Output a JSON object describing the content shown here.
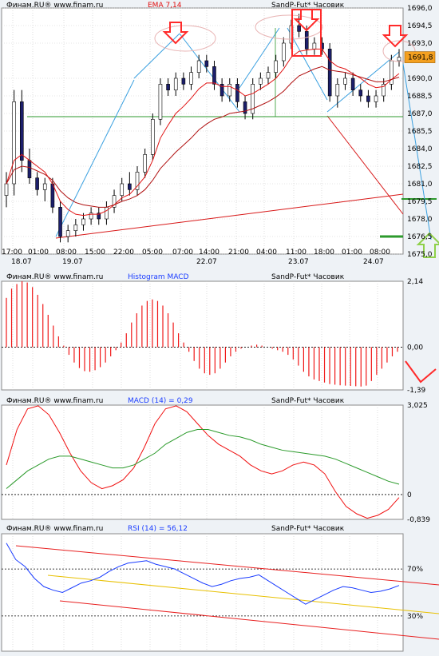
{
  "colors": {
    "bg": "#eef2f6",
    "plot": "#ffffff",
    "grid": "#c9c9c9",
    "candleUp": "#ffffff",
    "candleDown": "#1c1f6b",
    "candleEdge": "#000000",
    "emaFast": "#e01515",
    "emaSlow": "#b01010",
    "trend": "#3aa0e0",
    "support": "#d81818",
    "green": "#2c9a2c",
    "arrow": "#ff2a2a",
    "hist": "#f01818",
    "macd": "#f01010",
    "signal": "#2a9a2a",
    "rsi": "#1a3cff",
    "rsiTrend": "#e82020",
    "rsiMid": "#e8c000",
    "pill": "#e8b3b3",
    "priceBox": "#f4a020"
  },
  "panels": [
    {
      "id": "price",
      "source": "Финам.RU®  www.finam.ru",
      "indicator": "EMA 7,14",
      "instrument": "SandP-Fut* Часовик",
      "yticks": [
        "1696,0",
        "1694,5",
        "1693,0",
        "1691,8",
        "1690,0",
        "1688,5",
        "1687,0",
        "1685,5",
        "1684,0",
        "1682,5",
        "1681,0",
        "1679,5",
        "1678,0",
        "1676,5",
        "1675,0"
      ],
      "current_price": "1691,8"
    },
    {
      "id": "hist",
      "source": "Финам.RU®  www.finam.ru",
      "indicator": "Histogram MACD",
      "instrument": "SandP-Fut* Часовик",
      "yticks": [
        "2,14",
        "0,00",
        "-1,39"
      ]
    },
    {
      "id": "macd",
      "source": "Финам.RU®  www.finam.ru",
      "indicator": "MACD (14) = 0,29",
      "instrument": "SandP-Fut* Часовик",
      "yticks": [
        "3,025",
        "0",
        "-0,839"
      ]
    },
    {
      "id": "rsi",
      "source": "Финам.RU®  www.finam.ru",
      "indicator": "RSI (14) = 56,12",
      "instrument": "SandP-Fut* Часовик",
      "yticks": [
        "70%",
        "30%"
      ]
    }
  ],
  "xaxis": {
    "times": [
      "17:00",
      "01:00",
      "08:00",
      "15:00",
      "22:00",
      "05:00",
      "07:00",
      "14:00",
      "21:00",
      "04:00",
      "11:00",
      "18:00",
      "01:00",
      "08:00"
    ],
    "dates": [
      "18.07",
      "19.07",
      "22.07",
      "23.07",
      "24.07"
    ]
  },
  "chart_data": [
    {
      "type": "candlestick",
      "title": "SandP-Fut* Часовик",
      "indicator": "EMA 7,14",
      "ylim": [
        1675.0,
        1696.0
      ],
      "candles_ohlc": [
        [
          1680.0,
          1682.0,
          1679.0,
          1681.0
        ],
        [
          1681.0,
          1689.0,
          1680.0,
          1688.0
        ],
        [
          1688.0,
          1689.0,
          1682.0,
          1683.0
        ],
        [
          1683.0,
          1684.0,
          1681.0,
          1681.5
        ],
        [
          1681.5,
          1682.0,
          1680.0,
          1680.5
        ],
        [
          1680.5,
          1681.5,
          1679.5,
          1681.0
        ],
        [
          1681.0,
          1681.5,
          1678.5,
          1679.0
        ],
        [
          1679.0,
          1679.5,
          1676.0,
          1676.5
        ],
        [
          1676.5,
          1677.5,
          1676.0,
          1677.0
        ],
        [
          1677.0,
          1678.0,
          1676.5,
          1677.5
        ],
        [
          1677.5,
          1678.5,
          1677.0,
          1678.0
        ],
        [
          1678.0,
          1679.0,
          1677.5,
          1678.5
        ],
        [
          1678.5,
          1679.0,
          1677.5,
          1678.0
        ],
        [
          1678.0,
          1679.5,
          1677.5,
          1679.0
        ],
        [
          1679.0,
          1680.5,
          1678.5,
          1680.0
        ],
        [
          1680.0,
          1681.5,
          1679.5,
          1681.0
        ],
        [
          1681.0,
          1682.0,
          1680.0,
          1680.5
        ],
        [
          1680.5,
          1682.5,
          1680.0,
          1682.0
        ],
        [
          1682.0,
          1684.0,
          1681.5,
          1683.5
        ],
        [
          1683.5,
          1687.0,
          1683.0,
          1686.5
        ],
        [
          1686.5,
          1690.0,
          1686.0,
          1689.5
        ],
        [
          1689.5,
          1690.0,
          1688.5,
          1689.0
        ],
        [
          1689.0,
          1690.5,
          1688.5,
          1690.0
        ],
        [
          1690.0,
          1690.5,
          1689.0,
          1689.5
        ],
        [
          1689.5,
          1691.0,
          1689.0,
          1690.5
        ],
        [
          1690.5,
          1692.0,
          1690.0,
          1691.5
        ],
        [
          1691.5,
          1692.0,
          1690.5,
          1691.0
        ],
        [
          1691.0,
          1691.5,
          1689.0,
          1689.5
        ],
        [
          1689.5,
          1690.0,
          1688.0,
          1688.5
        ],
        [
          1688.5,
          1690.0,
          1688.0,
          1689.5
        ],
        [
          1689.5,
          1690.0,
          1687.5,
          1688.0
        ],
        [
          1688.0,
          1688.5,
          1686.5,
          1687.0
        ],
        [
          1687.0,
          1690.0,
          1686.5,
          1689.5
        ],
        [
          1689.5,
          1690.5,
          1689.0,
          1690.0
        ],
        [
          1690.0,
          1691.0,
          1689.5,
          1690.5
        ],
        [
          1690.5,
          1692.0,
          1690.0,
          1691.5
        ],
        [
          1691.5,
          1693.5,
          1691.0,
          1693.0
        ],
        [
          1693.0,
          1695.0,
          1692.5,
          1694.5
        ],
        [
          1694.5,
          1695.5,
          1693.5,
          1694.0
        ],
        [
          1694.0,
          1694.5,
          1692.0,
          1692.5
        ],
        [
          1692.5,
          1693.5,
          1692.0,
          1693.0
        ],
        [
          1693.0,
          1693.5,
          1692.0,
          1692.5
        ],
        [
          1692.5,
          1693.0,
          1688.0,
          1688.5
        ],
        [
          1688.5,
          1690.0,
          1687.5,
          1689.5
        ],
        [
          1689.5,
          1690.5,
          1689.0,
          1690.0
        ],
        [
          1690.0,
          1690.5,
          1688.5,
          1689.0
        ],
        [
          1689.0,
          1689.5,
          1688.0,
          1688.5
        ],
        [
          1688.5,
          1689.0,
          1687.5,
          1688.0
        ],
        [
          1688.0,
          1689.0,
          1687.5,
          1688.5
        ],
        [
          1688.5,
          1690.0,
          1688.0,
          1689.5
        ],
        [
          1689.5,
          1692.0,
          1689.0,
          1691.5
        ],
        [
          1691.5,
          1692.5,
          1691.0,
          1691.8
        ]
      ],
      "ema_fast": [
        1681.0,
        1683.0,
        1683.5,
        1683.0,
        1682.5,
        1682.0,
        1681.0,
        1679.5,
        1678.8,
        1678.4,
        1678.3,
        1678.4,
        1678.4,
        1678.7,
        1679.2,
        1679.8,
        1680.1,
        1680.8,
        1681.6,
        1683.0,
        1684.9,
        1686.0,
        1687.0,
        1687.6,
        1688.3,
        1689.1,
        1689.6,
        1689.6,
        1689.3,
        1689.3,
        1689.0,
        1688.5,
        1688.7,
        1689.1,
        1689.5,
        1690.0,
        1690.8,
        1691.8,
        1692.3,
        1692.4,
        1692.5,
        1692.5,
        1691.5,
        1691.0,
        1690.8,
        1690.4,
        1690.0,
        1689.5,
        1689.2,
        1689.3,
        1689.9,
        1690.4
      ],
      "ema_slow": [
        1681.0,
        1682.2,
        1682.5,
        1682.4,
        1682.1,
        1681.8,
        1681.3,
        1680.4,
        1679.8,
        1679.4,
        1679.2,
        1679.1,
        1679.0,
        1679.0,
        1679.2,
        1679.5,
        1679.7,
        1680.0,
        1680.5,
        1681.3,
        1682.3,
        1683.0,
        1683.7,
        1684.3,
        1684.9,
        1685.6,
        1686.1,
        1686.5,
        1686.7,
        1687.0,
        1687.1,
        1687.2,
        1687.4,
        1687.7,
        1688.0,
        1688.4,
        1688.9,
        1689.6,
        1690.2,
        1690.5,
        1690.8,
        1691.0,
        1690.7,
        1690.6,
        1690.5,
        1690.3,
        1690.1,
        1689.9,
        1689.7,
        1689.7,
        1689.9,
        1690.1
      ]
    },
    {
      "type": "bar",
      "title": "Histogram MACD",
      "ylim": [
        -1.39,
        2.14
      ],
      "values": [
        1.6,
        1.9,
        2.05,
        2.14,
        2.1,
        1.95,
        1.7,
        1.4,
        1.05,
        0.7,
        0.35,
        0.05,
        -0.25,
        -0.5,
        -0.68,
        -0.78,
        -0.8,
        -0.75,
        -0.65,
        -0.5,
        -0.3,
        -0.1,
        0.15,
        0.45,
        0.8,
        1.1,
        1.35,
        1.5,
        1.55,
        1.5,
        1.35,
        1.1,
        0.8,
        0.45,
        0.15,
        -0.15,
        -0.45,
        -0.7,
        -0.85,
        -0.9,
        -0.85,
        -0.7,
        -0.5,
        -0.3,
        -0.15,
        -0.05,
        0.0,
        0.05,
        0.08,
        0.05,
        0.0,
        -0.05,
        -0.1,
        -0.15,
        -0.25,
        -0.4,
        -0.6,
        -0.8,
        -0.95,
        -1.05,
        -1.1,
        -1.15,
        -1.2,
        -1.22,
        -1.24,
        -1.25,
        -1.26,
        -1.27,
        -1.28,
        -1.25,
        -1.1,
        -0.9,
        -0.7,
        -0.5,
        -0.3,
        -0.15
      ],
      "forecast_points": [
        [
          0,
          -0.3
        ],
        [
          1,
          -0.9
        ],
        [
          2,
          -0.7
        ]
      ]
    },
    {
      "type": "line",
      "title": "MACD (14) = 0,29",
      "ylim": [
        -0.839,
        3.025
      ],
      "series": [
        {
          "name": "MACD",
          "values": [
            1.0,
            2.2,
            2.9,
            3.0,
            2.7,
            2.1,
            1.4,
            0.8,
            0.4,
            0.2,
            0.3,
            0.5,
            0.9,
            1.6,
            2.4,
            2.9,
            3.0,
            2.8,
            2.4,
            2.0,
            1.7,
            1.5,
            1.3,
            1.0,
            0.8,
            0.7,
            0.8,
            1.0,
            1.1,
            1.0,
            0.7,
            0.1,
            -0.4,
            -0.65,
            -0.8,
            -0.7,
            -0.5,
            -0.1
          ]
        },
        {
          "name": "Signal",
          "values": [
            0.2,
            0.5,
            0.8,
            1.0,
            1.2,
            1.3,
            1.3,
            1.2,
            1.1,
            1.0,
            0.9,
            0.9,
            1.0,
            1.2,
            1.4,
            1.7,
            1.9,
            2.1,
            2.2,
            2.2,
            2.1,
            2.0,
            1.95,
            1.85,
            1.7,
            1.6,
            1.5,
            1.45,
            1.4,
            1.35,
            1.3,
            1.2,
            1.05,
            0.9,
            0.75,
            0.6,
            0.45,
            0.35
          ]
        }
      ]
    },
    {
      "type": "line",
      "title": "RSI (14) = 56,12",
      "ylim": [
        0,
        100
      ],
      "levels": [
        70,
        30
      ],
      "series": [
        {
          "name": "RSI",
          "values": [
            92,
            78,
            72,
            62,
            55,
            52,
            50,
            54,
            58,
            60,
            63,
            68,
            72,
            75,
            76,
            77,
            74,
            72,
            70,
            66,
            62,
            58,
            55,
            57,
            60,
            62,
            63,
            65,
            60,
            55,
            50,
            45,
            40,
            44,
            48,
            52,
            55,
            54,
            52,
            50,
            51,
            53,
            56
          ]
        }
      ]
    }
  ]
}
